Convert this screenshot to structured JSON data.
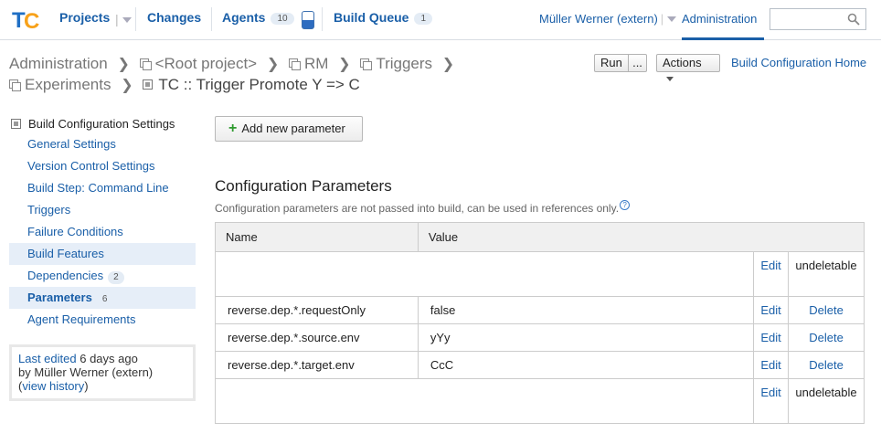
{
  "nav": {
    "projects": "Projects",
    "changes": "Changes",
    "agents": "Agents",
    "agents_count": "10",
    "build_queue": "Build Queue",
    "queue_count": "1",
    "user": "Müller Werner (extern)",
    "administration": "Administration",
    "search_placeholder": ""
  },
  "breadcrumb": {
    "row1": [
      "Administration",
      "<Root project>",
      "RM",
      "Triggers"
    ],
    "row2_project": "Experiments",
    "current": "TC :: Trigger Promote Y => C"
  },
  "toolbar": {
    "run": "Run",
    "run_more": "...",
    "actions": "Actions",
    "bc_home": "Build Configuration Home"
  },
  "sidebar": {
    "title": "Build Configuration Settings",
    "items": [
      {
        "label": "General Settings",
        "count": ""
      },
      {
        "label": "Version Control Settings",
        "count": ""
      },
      {
        "label": "Build Step: Command Line",
        "count": ""
      },
      {
        "label": "Triggers",
        "count": ""
      },
      {
        "label": "Failure Conditions",
        "count": ""
      },
      {
        "label": "Build Features",
        "count": ""
      },
      {
        "label": "Dependencies",
        "count": "2"
      },
      {
        "label": "Parameters",
        "count": "6"
      },
      {
        "label": "Agent Requirements",
        "count": ""
      }
    ],
    "last_edited_label": "Last edited",
    "last_edited_when": "6 days ago",
    "by": "by Müller Werner (extern)",
    "view_history": "view history"
  },
  "main": {
    "add_param": "Add new parameter",
    "section_title": "Configuration Parameters",
    "section_note": "Configuration parameters are not passed into build, can be used in references only.",
    "col_name": "Name",
    "col_value": "Value",
    "rows": [
      {
        "name": "",
        "value": "",
        "edit": "Edit",
        "action": "undeletable"
      },
      {
        "name": "reverse.dep.*.requestOnly",
        "value": "false",
        "edit": "Edit",
        "action": "Delete"
      },
      {
        "name": "reverse.dep.*.source.env",
        "value": "yYy",
        "edit": "Edit",
        "action": "Delete"
      },
      {
        "name": "reverse.dep.*.target.env",
        "value": "CcC",
        "edit": "Edit",
        "action": "Delete"
      },
      {
        "name": "",
        "value": "",
        "edit": "Edit",
        "action": "undeletable"
      }
    ]
  },
  "colors": {
    "link": "#1a5fa8",
    "logo_orange": "#f7a21b",
    "logo_blue": "#1f6fc5",
    "active_bg": "#e6eef8"
  }
}
